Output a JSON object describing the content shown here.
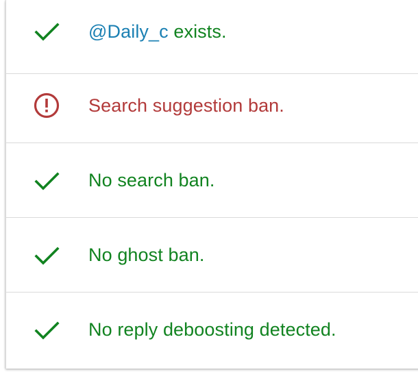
{
  "results": {
    "exists": {
      "icon": "check-icon",
      "handle": "@Daily_c",
      "suffix": " exists."
    },
    "search_suggestion": {
      "icon": "alert-circle-icon",
      "text": "Search suggestion ban."
    },
    "search_ban": {
      "icon": "check-icon",
      "text": "No search ban."
    },
    "ghost_ban": {
      "icon": "check-icon",
      "text": "No ghost ban."
    },
    "reply_deboosting": {
      "icon": "check-icon",
      "text": "No reply deboosting detected."
    }
  },
  "colors": {
    "ok": "#118320",
    "warn": "#b23a3a",
    "handle": "#1b80b3",
    "divider": "#dadada"
  }
}
